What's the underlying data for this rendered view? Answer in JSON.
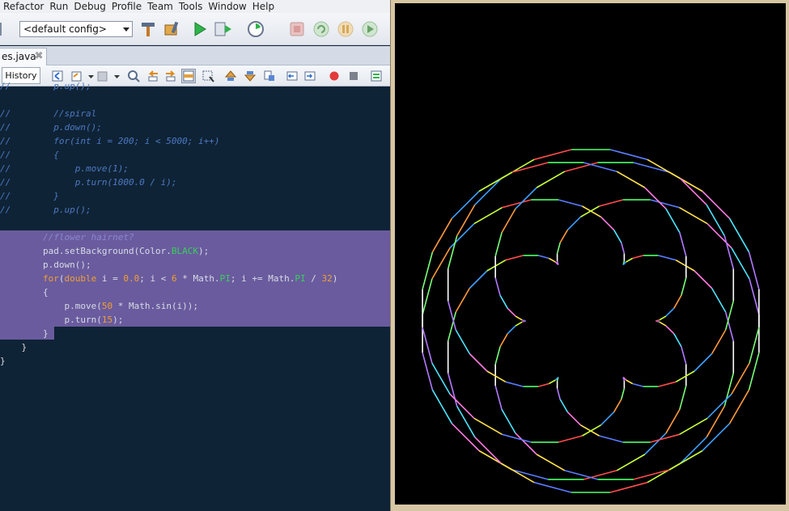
{
  "menu": [
    "Refactor",
    "Run",
    "Debug",
    "Profile",
    "Team",
    "Tools",
    "Window",
    "Help"
  ],
  "toolbar": {
    "config_value": "<default config>",
    "icons": [
      "build-icon",
      "clean-build-icon",
      "run-icon",
      "debug-icon",
      "profile-icon",
      "stop-icon",
      "apply-code-changes-icon",
      "pause-icon",
      "continue-icon"
    ]
  },
  "editor_tab": {
    "filename": "es.java",
    "close_glyph": "⌘"
  },
  "history_label": "History",
  "code_lines": [
    {
      "indent": 0,
      "parts": [
        {
          "t": "//        p.up();",
          "c": "cmt"
        }
      ]
    },
    {
      "indent": 0,
      "parts": [
        {
          "t": "",
          "c": ""
        }
      ]
    },
    {
      "indent": 0,
      "parts": [
        {
          "t": "//        //spiral",
          "c": "cmt"
        }
      ]
    },
    {
      "indent": 0,
      "parts": [
        {
          "t": "//        p.down();",
          "c": "cmt"
        }
      ]
    },
    {
      "indent": 0,
      "parts": [
        {
          "t": "//        for(int i = 200; i < 5000; i++)",
          "c": "cmt"
        }
      ]
    },
    {
      "indent": 0,
      "parts": [
        {
          "t": "//        {",
          "c": "cmt"
        }
      ]
    },
    {
      "indent": 0,
      "parts": [
        {
          "t": "//            p.move(1);",
          "c": "cmt"
        }
      ]
    },
    {
      "indent": 0,
      "parts": [
        {
          "t": "//            p.turn(1000.0 / i);",
          "c": "cmt"
        }
      ]
    },
    {
      "indent": 0,
      "parts": [
        {
          "t": "//        }",
          "c": "cmt"
        }
      ]
    },
    {
      "indent": 0,
      "parts": [
        {
          "t": "//        p.up();",
          "c": "cmt"
        }
      ]
    },
    {
      "indent": 0,
      "parts": [
        {
          "t": "",
          "c": ""
        }
      ]
    },
    {
      "indent": 0,
      "parts": [
        {
          "t": "        ",
          "c": ""
        },
        {
          "t": "//flower hairnet?",
          "c": "cmt-sel"
        }
      ]
    },
    {
      "indent": 0,
      "parts": [
        {
          "t": "        pad.setBackground(Color.",
          "c": ""
        },
        {
          "t": "BLACK",
          "c": "const"
        },
        {
          "t": ");",
          "c": ""
        }
      ]
    },
    {
      "indent": 0,
      "parts": [
        {
          "t": "        p.down();",
          "c": ""
        }
      ]
    },
    {
      "indent": 0,
      "parts": [
        {
          "t": "        ",
          "c": ""
        },
        {
          "t": "for",
          "c": "kw"
        },
        {
          "t": "(",
          "c": ""
        },
        {
          "t": "double",
          "c": "kw"
        },
        {
          "t": " i = ",
          "c": ""
        },
        {
          "t": "0.0",
          "c": "num"
        },
        {
          "t": "; i < ",
          "c": ""
        },
        {
          "t": "6",
          "c": "num"
        },
        {
          "t": " * Math.",
          "c": ""
        },
        {
          "t": "PI",
          "c": "const"
        },
        {
          "t": "; i += Math.",
          "c": ""
        },
        {
          "t": "PI",
          "c": "const"
        },
        {
          "t": " / ",
          "c": ""
        },
        {
          "t": "32",
          "c": "num"
        },
        {
          "t": ")",
          "c": ""
        }
      ]
    },
    {
      "indent": 0,
      "parts": [
        {
          "t": "        {",
          "c": ""
        }
      ]
    },
    {
      "indent": 0,
      "parts": [
        {
          "t": "            p.move(",
          "c": ""
        },
        {
          "t": "50",
          "c": "num"
        },
        {
          "t": " * Math.sin(i));",
          "c": ""
        }
      ]
    },
    {
      "indent": 0,
      "parts": [
        {
          "t": "            p.turn(",
          "c": ""
        },
        {
          "t": "15",
          "c": "num"
        },
        {
          "t": ");",
          "c": ""
        }
      ]
    },
    {
      "indent": 0,
      "parts": [
        {
          "t": "        }",
          "c": ""
        }
      ]
    },
    {
      "indent": 0,
      "parts": [
        {
          "t": "    }",
          "c": ""
        }
      ]
    },
    {
      "indent": 0,
      "parts": [
        {
          "t": "}",
          "c": ""
        }
      ]
    }
  ],
  "colors": {
    "editor_bg": "#0f2336",
    "selection": "#6a5b9e",
    "comment": "#4b79c2",
    "keyword": "#f0a030",
    "constant": "#37d15a",
    "canvas_bg": "#000000",
    "frame": "#d7c6a3"
  },
  "drawing": {
    "description_icon": "turtle-graphics-canvas",
    "palette": [
      "#ff4d4d",
      "#4dff6a",
      "#5a7dff",
      "#ffe14d",
      "#ff7ae0",
      "#4de6ff",
      "#b37aff",
      "#ffffff",
      "#7aff7a",
      "#ff9a3c",
      "#3ca0ff",
      "#c8ff3c"
    ]
  }
}
